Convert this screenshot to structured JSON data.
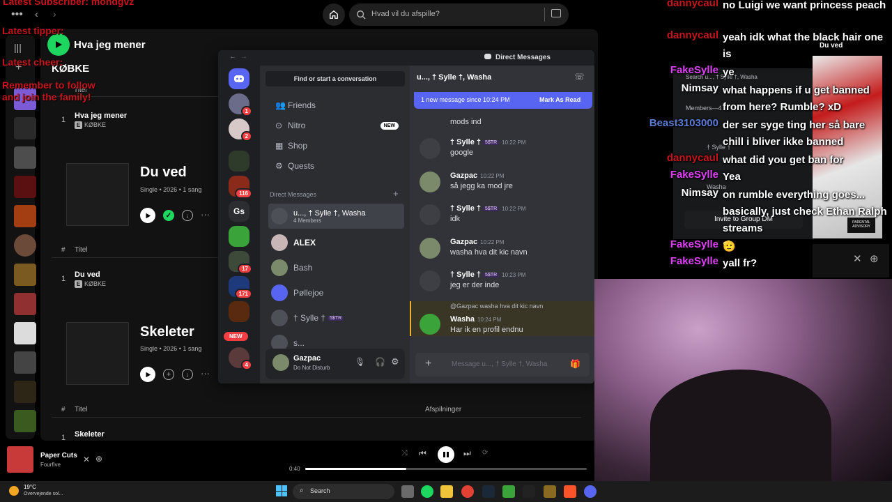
{
  "spotify": {
    "search_placeholder": "Hvad vil du afspille?",
    "now_playing_header": "Hva jeg mener",
    "artist_heading": "KØBKE",
    "col_title": "Titel",
    "col_plays": "Afspilninger",
    "tracks": [
      {
        "title": "Hva jeg mener",
        "artist": "KØBKE"
      },
      {
        "title": "Du ved",
        "artist": "KØBKE"
      },
      {
        "title": "Skeleter",
        "artist": ""
      }
    ],
    "releases": [
      {
        "title": "Du ved",
        "meta": "Single • 2026 • 1 sang"
      },
      {
        "title": "Skeleter",
        "meta": "Single • 2026 • 1 sang"
      }
    ],
    "player": {
      "song": "Paper Cuts",
      "artist": "Fourfive",
      "elapsed": "0:40",
      "progress": 0.36
    }
  },
  "stream_overlay": {
    "latest_subscriber": "Latest Subscriber: mondgvz",
    "latest_tipper": "Latest tipper:",
    "latest_cheer": "Latest cheer:",
    "reminder": "Remember to follow and join the family!"
  },
  "discord": {
    "window_title": "Direct Messages",
    "find_placeholder": "Find or start a conversation",
    "nav": [
      {
        "label": "Friends",
        "icon": "friends-icon"
      },
      {
        "label": "Nitro",
        "icon": "nitro-icon",
        "badge": "NEW"
      },
      {
        "label": "Shop",
        "icon": "shop-icon"
      },
      {
        "label": "Quests",
        "icon": "quests-icon"
      }
    ],
    "dm_header": "Direct Messages",
    "dms": [
      {
        "name": "u..., † Sylle †, Washa",
        "sub": "4 Members"
      },
      {
        "name": "ALEX",
        "sub": ""
      },
      {
        "name": "Bash",
        "sub": ""
      },
      {
        "name": "Pøllejoe",
        "sub": ""
      },
      {
        "name": "† Sylle †",
        "sub": "",
        "tag": "5$TR"
      },
      {
        "name": "s...",
        "sub": ""
      }
    ],
    "guild_badges": [
      "1",
      "2",
      "116",
      "17",
      "171",
      "4"
    ],
    "guild_text": "Gs",
    "new_pill": "NEW",
    "user": {
      "name": "Gazpac",
      "status": "Do Not Disturb"
    },
    "channel_title": "u..., † Sylle †, Washa",
    "new_messages_banner": "1 new message since 10:24 PM",
    "mark_as_read": "Mark As Read",
    "messages": [
      {
        "author": "",
        "time": "",
        "text": "mods ind"
      },
      {
        "author": "† Sylle †",
        "tag": "5$TR",
        "time": "10:22 PM",
        "text": "google"
      },
      {
        "author": "Gazpac",
        "time": "10:22 PM",
        "text": "så jegg ka mod jre"
      },
      {
        "author": "† Sylle †",
        "tag": "5$TR",
        "time": "10:22 PM",
        "text": "idk"
      },
      {
        "author": "Gazpac",
        "time": "10:22 PM",
        "text": "washa hva  dit kic navn"
      },
      {
        "author": "† Sylle †",
        "tag": "5$TR",
        "time": "10:23 PM",
        "text": "jeg er der inde"
      },
      {
        "author": "Washa",
        "time": "10:24 PM",
        "text": "Har ik en profil endnu",
        "reply_to": "@Gazpac",
        "reply_text": "washa hva  dit kic navn"
      }
    ],
    "composer_placeholder": "Message u..., † Sylle †, Washa",
    "members_panel": {
      "search": "Search u..., † Sylle †, Washa",
      "header": "Members—4",
      "invite": "Invite to Group DM",
      "members": [
        "† Sylle †",
        "Washa"
      ]
    }
  },
  "album_overlay": {
    "title": "Du ved"
  },
  "live_chat": [
    {
      "user": "dannycaul",
      "color": "#c6151c",
      "text": "no Luigi we want princess peach"
    },
    {
      "user": "dannycaul",
      "color": "#c6151c",
      "text": "yeah idk what the black hair one is"
    },
    {
      "user": "FakeSylle",
      "color": "#e040fb",
      "text": "ye"
    },
    {
      "user": "Nimsay",
      "color": "#ffffff",
      "text": "what happens if u get banned from here? Rumble? xD"
    },
    {
      "user": "Beast3103000",
      "color": "#5b7bd5",
      "text": "der ser syge ting her så bare chill i bliver ikke banned"
    },
    {
      "user": "dannycaul",
      "color": "#c6151c",
      "text": "what did you get ban for"
    },
    {
      "user": "FakeSylle",
      "color": "#e040fb",
      "text": "Yea"
    },
    {
      "user": "Nimsay",
      "color": "#ffffff",
      "text": "on rumble everything goes... basically, just check Ethan Ralph streams"
    },
    {
      "user": "FakeSylle",
      "color": "#e040fb",
      "text": "🫡"
    },
    {
      "user": "FakeSylle",
      "color": "#e040fb",
      "text": "yall fr?"
    }
  ],
  "taskbar": {
    "weather_temp": "19°C",
    "weather_desc": "Overvejende sol...",
    "search": "Search"
  },
  "colors": {
    "spotify_green": "#1ed760",
    "discord_blurple": "#5865f2",
    "red_overlay": "#c6151c"
  }
}
